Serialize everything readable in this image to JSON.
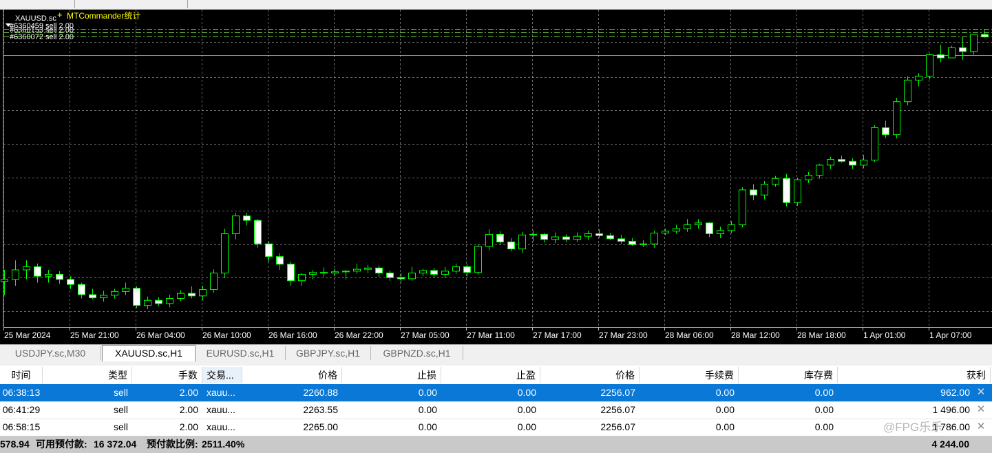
{
  "chart": {
    "title": "XAUUSD.sc",
    "indicator_label": "MTCommander统计",
    "order_lines": [
      "#6360459 sell 2.00",
      "#6360153 sell 2.00",
      "#6360072 sell 2.00"
    ],
    "colors": {
      "background": "#000000",
      "grid": "#c0c0c0",
      "candle_outline": "#00ff00",
      "bull_fill": "#000000",
      "bear_fill": "#ffffff",
      "indicator_text": "#ffff00",
      "order_line": "#6fc846",
      "bid_line": "#c0c0c0"
    },
    "time_labels": [
      "25 Mar 2024",
      "25 Mar 21:00",
      "26 Mar 04:00",
      "26 Mar 10:00",
      "26 Mar 16:00",
      "26 Mar 22:00",
      "27 Mar 05:00",
      "27 Mar 11:00",
      "27 Mar 17:00",
      "27 Mar 23:00",
      "28 Mar 06:00",
      "28 Mar 12:00",
      "28 Mar 18:00",
      "1 Apr 01:00",
      "1 Apr 07:00"
    ]
  },
  "chart_data": {
    "type": "candlestick",
    "symbol": "XAUUSD.sc",
    "timeframe": "H1",
    "ohlc": [
      [
        2173.7,
        2175.5,
        2171.5,
        2174.0
      ],
      [
        2174.0,
        2177.0,
        2173.0,
        2175.5
      ],
      [
        2175.5,
        2177.0,
        2174.0,
        2176.0
      ],
      [
        2176.0,
        2176.5,
        2173.5,
        2174.5
      ],
      [
        2174.5,
        2175.5,
        2173.5,
        2174.8
      ],
      [
        2174.8,
        2175.3,
        2173.3,
        2174.0
      ],
      [
        2174.0,
        2174.5,
        2172.5,
        2173.2
      ],
      [
        2173.2,
        2173.5,
        2171.0,
        2171.6
      ],
      [
        2171.6,
        2172.5,
        2170.9,
        2171.1
      ],
      [
        2171.1,
        2172.2,
        2170.5,
        2171.5
      ],
      [
        2171.5,
        2172.5,
        2171.0,
        2172.1
      ],
      [
        2172.1,
        2173.5,
        2171.5,
        2172.6
      ],
      [
        2172.6,
        2172.9,
        2169.5,
        2169.9
      ],
      [
        2169.9,
        2171.3,
        2169.3,
        2170.7
      ],
      [
        2170.7,
        2171.2,
        2169.8,
        2170.2
      ],
      [
        2170.2,
        2171.6,
        2169.6,
        2171.0
      ],
      [
        2171.0,
        2172.3,
        2170.6,
        2171.8
      ],
      [
        2171.8,
        2172.9,
        2171.0,
        2171.4
      ],
      [
        2171.4,
        2173.0,
        2170.7,
        2172.4
      ],
      [
        2172.4,
        2175.6,
        2171.9,
        2175.0
      ],
      [
        2175.0,
        2182.0,
        2174.2,
        2181.2
      ],
      [
        2181.2,
        2184.5,
        2180.3,
        2184.0
      ],
      [
        2184.0,
        2184.5,
        2182.5,
        2183.3
      ],
      [
        2183.3,
        2183.5,
        2179.0,
        2179.6
      ],
      [
        2179.6,
        2180.0,
        2176.7,
        2177.6
      ],
      [
        2177.6,
        2178.1,
        2175.5,
        2176.4
      ],
      [
        2176.4,
        2176.8,
        2173.0,
        2173.8
      ],
      [
        2173.8,
        2175.0,
        2173.0,
        2174.8
      ],
      [
        2174.8,
        2175.5,
        2174.0,
        2175.1
      ],
      [
        2175.1,
        2175.9,
        2174.4,
        2175.0
      ],
      [
        2175.0,
        2175.7,
        2174.6,
        2175.2
      ],
      [
        2175.2,
        2175.5,
        2174.0,
        2175.3
      ],
      [
        2175.3,
        2176.5,
        2174.9,
        2175.6
      ],
      [
        2175.6,
        2176.3,
        2175.0,
        2175.8
      ],
      [
        2175.8,
        2176.2,
        2174.4,
        2175.0
      ],
      [
        2175.0,
        2175.4,
        2173.8,
        2174.3
      ],
      [
        2174.3,
        2175.0,
        2173.5,
        2174.1
      ],
      [
        2174.1,
        2176.0,
        2173.8,
        2175.0
      ],
      [
        2175.0,
        2175.7,
        2174.5,
        2175.4
      ],
      [
        2175.4,
        2175.8,
        2174.3,
        2174.8
      ],
      [
        2174.8,
        2176.0,
        2174.2,
        2175.3
      ],
      [
        2175.3,
        2176.5,
        2174.9,
        2176.0
      ],
      [
        2176.0,
        2176.4,
        2174.5,
        2175.1
      ],
      [
        2175.1,
        2179.5,
        2174.8,
        2179.2
      ],
      [
        2179.2,
        2181.9,
        2178.6,
        2181.1
      ],
      [
        2181.1,
        2181.6,
        2179.5,
        2179.9
      ],
      [
        2179.9,
        2180.5,
        2178.4,
        2178.8
      ],
      [
        2178.8,
        2181.5,
        2178.2,
        2181.0
      ],
      [
        2181.0,
        2181.7,
        2180.0,
        2181.1
      ],
      [
        2181.1,
        2181.3,
        2179.8,
        2180.3
      ],
      [
        2180.3,
        2181.4,
        2179.7,
        2180.7
      ],
      [
        2180.7,
        2181.1,
        2179.9,
        2180.3
      ],
      [
        2180.3,
        2181.4,
        2179.9,
        2180.8
      ],
      [
        2180.8,
        2181.7,
        2180.2,
        2181.2
      ],
      [
        2181.2,
        2181.9,
        2180.5,
        2180.9
      ],
      [
        2180.9,
        2181.3,
        2180.2,
        2180.4
      ],
      [
        2180.4,
        2181.0,
        2179.6,
        2180.0
      ],
      [
        2180.0,
        2180.5,
        2179.3,
        2179.5
      ],
      [
        2179.5,
        2180.2,
        2179.1,
        2179.6
      ],
      [
        2179.6,
        2181.7,
        2179.0,
        2181.3
      ],
      [
        2181.3,
        2182.0,
        2181.0,
        2181.6
      ],
      [
        2181.6,
        2182.6,
        2181.2,
        2182.0
      ],
      [
        2182.0,
        2183.5,
        2181.5,
        2182.6
      ],
      [
        2182.6,
        2183.5,
        2182.0,
        2182.9
      ],
      [
        2182.9,
        2183.0,
        2180.7,
        2181.2
      ],
      [
        2181.2,
        2182.3,
        2180.5,
        2181.7
      ],
      [
        2181.7,
        2183.2,
        2181.3,
        2182.6
      ],
      [
        2182.6,
        2188.5,
        2182.2,
        2188.1
      ],
      [
        2188.1,
        2189.0,
        2186.5,
        2187.3
      ],
      [
        2187.3,
        2189.5,
        2186.6,
        2189.0
      ],
      [
        2189.0,
        2190.3,
        2188.6,
        2189.9
      ],
      [
        2189.9,
        2190.6,
        2185.5,
        2186.1
      ],
      [
        2186.1,
        2190.0,
        2185.6,
        2189.7
      ],
      [
        2189.7,
        2190.9,
        2189.2,
        2190.4
      ],
      [
        2190.4,
        2192.2,
        2189.9,
        2192.0
      ],
      [
        2192.0,
        2193.3,
        2191.4,
        2192.9
      ],
      [
        2192.9,
        2193.5,
        2192.4,
        2192.6
      ],
      [
        2192.6,
        2193.1,
        2191.4,
        2192.0
      ],
      [
        2192.0,
        2193.6,
        2191.5,
        2192.8
      ],
      [
        2192.8,
        2198.3,
        2192.5,
        2197.9
      ],
      [
        2197.9,
        2199.0,
        2196.3,
        2196.8
      ],
      [
        2196.8,
        2202.6,
        2196.2,
        2202.0
      ],
      [
        2202.0,
        2206.0,
        2201.4,
        2205.4
      ],
      [
        2205.4,
        2206.5,
        2204.4,
        2206.0
      ],
      [
        2206.0,
        2209.6,
        2205.5,
        2209.4
      ],
      [
        2209.4,
        2211.0,
        2208.2,
        2208.9
      ],
      [
        2208.9,
        2210.8,
        2209.4,
        2210.5
      ],
      [
        2210.5,
        2212.2,
        2208.6,
        2209.9
      ],
      [
        2209.9,
        2212.7,
        2209.4,
        2212.6
      ],
      [
        2212.6,
        2213.3,
        2212.1,
        2212.2
      ],
      [
        2212.2,
        2212.8,
        2211.1,
        2211.8
      ],
      [
        2211.8,
        2212.6,
        2210.6,
        2211.2
      ]
    ],
    "time_axis": [
      "25 Mar 2024",
      "25 Mar 21:00",
      "26 Mar 04:00",
      "26 Mar 10:00",
      "26 Mar 16:00",
      "26 Mar 22:00",
      "27 Mar 05:00",
      "27 Mar 11:00",
      "27 Mar 17:00",
      "27 Mar 23:00",
      "28 Mar 06:00",
      "28 Mar 12:00",
      "28 Mar 18:00",
      "1 Apr 01:00",
      "1 Apr 07:00"
    ],
    "grid": true
  },
  "tabs": [
    {
      "label": "USDJPY.sc,M30",
      "active": false
    },
    {
      "label": "XAUUSD.sc,H1",
      "active": true
    },
    {
      "label": "EURUSD.sc,H1",
      "active": false
    },
    {
      "label": "GBPJPY.sc,H1",
      "active": false
    },
    {
      "label": "GBPNZD.sc,H1",
      "active": false
    }
  ],
  "terminal": {
    "columns": [
      "时间",
      "类型",
      "手数",
      "交易...",
      "价格",
      "止损",
      "止盈",
      "价格",
      "手续费",
      "库存费",
      "获利"
    ],
    "rows": [
      {
        "time": "06:38:13",
        "type": "sell",
        "lots": "2.00",
        "symbol": "xauu...",
        "open_price": "2260.88",
        "sl": "0.00",
        "tp": "0.00",
        "price": "2256.07",
        "commission": "0.00",
        "swap": "0.00",
        "profit": "962.00",
        "selected": true
      },
      {
        "time": "06:41:29",
        "type": "sell",
        "lots": "2.00",
        "symbol": "xauu...",
        "open_price": "2263.55",
        "sl": "0.00",
        "tp": "0.00",
        "price": "2256.07",
        "commission": "0.00",
        "swap": "0.00",
        "profit": "1 496.00",
        "selected": false
      },
      {
        "time": "06:58:15",
        "type": "sell",
        "lots": "2.00",
        "symbol": "xauu...",
        "open_price": "2265.00",
        "sl": "0.00",
        "tp": "0.00",
        "price": "2256.07",
        "commission": "0.00",
        "swap": "0.00",
        "profit": "1 786.00",
        "selected": false
      }
    ],
    "close_glyph": "✕",
    "summary": {
      "left_fragment": "578.94",
      "free_margin_label": "可用预付款:",
      "free_margin_value": "16 372.04",
      "margin_level_label": "预付款比例:",
      "margin_level_value": "2511.40%",
      "total_profit": "4 244.00"
    },
    "selected_color": "#0a78d7"
  },
  "watermark": "@FPG乐乐"
}
